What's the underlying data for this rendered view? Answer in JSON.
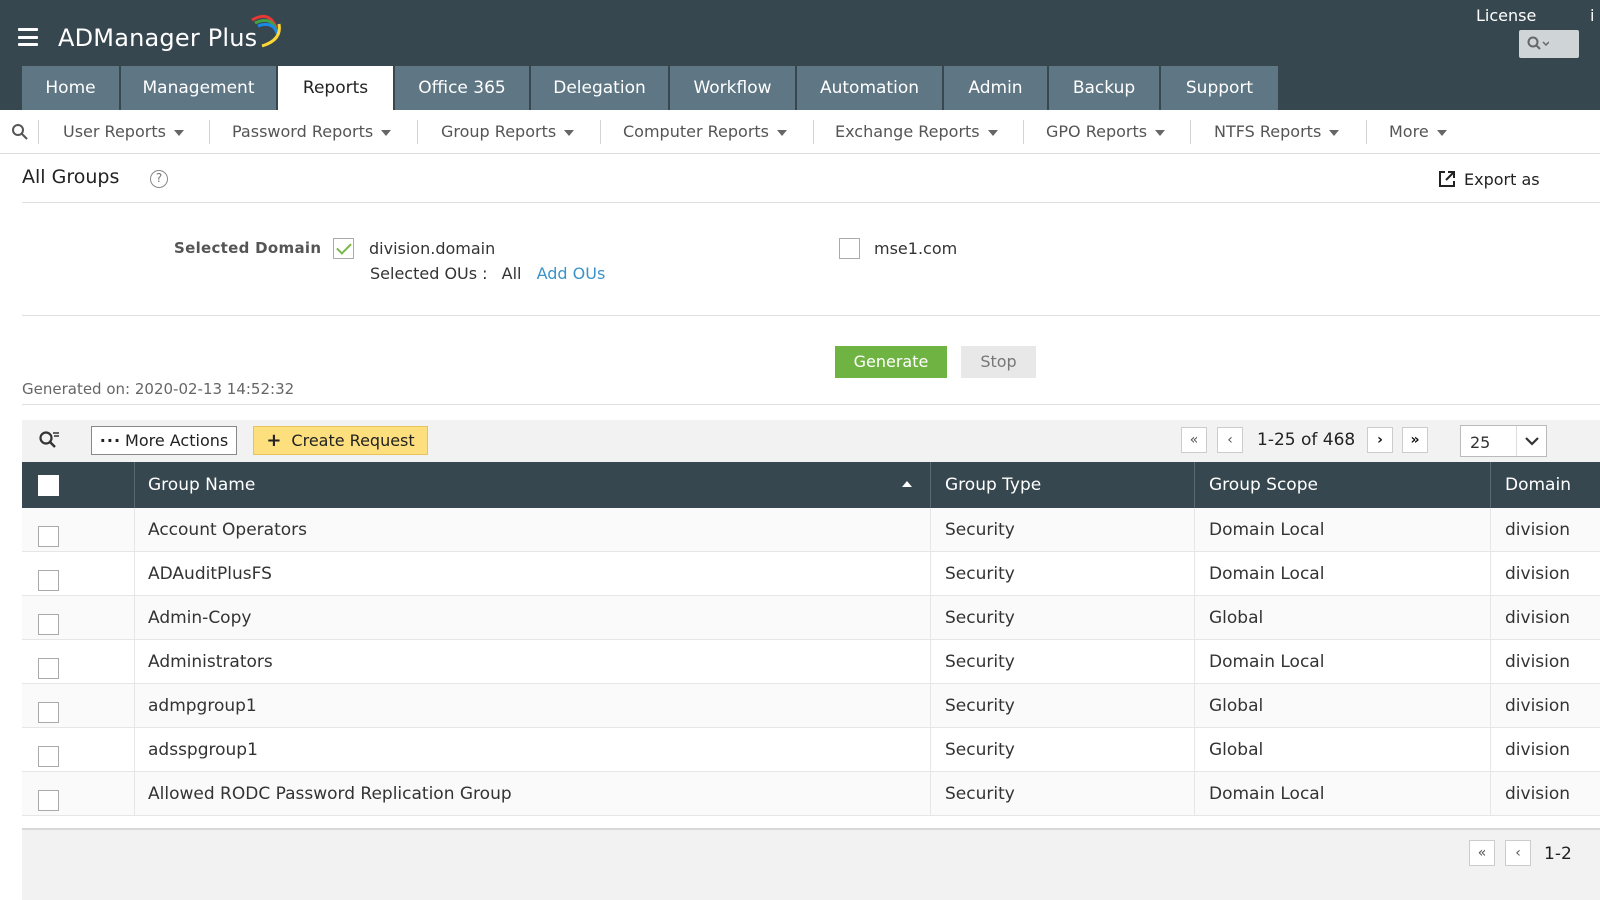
{
  "header": {
    "app_name": "ADManager Plus",
    "license_label": "License",
    "info_glyph": "i"
  },
  "main_tabs": [
    {
      "label": "Home",
      "active": false
    },
    {
      "label": "Management",
      "active": false
    },
    {
      "label": "Reports",
      "active": true
    },
    {
      "label": "Office 365",
      "active": false
    },
    {
      "label": "Delegation",
      "active": false
    },
    {
      "label": "Workflow",
      "active": false
    },
    {
      "label": "Automation",
      "active": false
    },
    {
      "label": "Admin",
      "active": false
    },
    {
      "label": "Backup",
      "active": false
    },
    {
      "label": "Support",
      "active": false
    }
  ],
  "sub_nav": [
    {
      "label": "User Reports"
    },
    {
      "label": "Password Reports"
    },
    {
      "label": "Group Reports"
    },
    {
      "label": "Computer Reports"
    },
    {
      "label": "Exchange Reports"
    },
    {
      "label": "GPO Reports"
    },
    {
      "label": "NTFS Reports"
    },
    {
      "label": "More"
    }
  ],
  "page": {
    "title": "All Groups",
    "help_glyph": "?",
    "export_label": "Export as"
  },
  "domain_selection": {
    "label": "Selected Domain",
    "domains": [
      {
        "name": "division.domain",
        "checked": true
      },
      {
        "name": "mse1.com",
        "checked": false
      }
    ],
    "selected_ous_label": "Selected OUs :",
    "selected_ous_value": "All",
    "add_ous_label": "Add OUs"
  },
  "actions": {
    "generate_label": "Generate",
    "stop_label": "Stop",
    "generated_on": "Generated on: 2020-02-13 14:52:32"
  },
  "toolbar": {
    "more_actions_label": "More Actions",
    "create_request_label": "Create Request",
    "page_info": "1-25 of 468",
    "page_size": "25",
    "colors": {
      "create_request_bg": "#fddf7e",
      "generate_bg": "#6fb443"
    }
  },
  "table": {
    "columns": [
      "Group Name",
      "Group Type",
      "Group Scope",
      "Domain"
    ],
    "sort_column": "Group Name",
    "sort_direction": "asc",
    "rows": [
      {
        "name": "Account Operators",
        "type": "Security",
        "scope": "Domain Local",
        "domain": "division"
      },
      {
        "name": "ADAuditPlusFS",
        "type": "Security",
        "scope": "Domain Local",
        "domain": "division"
      },
      {
        "name": "Admin-Copy",
        "type": "Security",
        "scope": "Global",
        "domain": "division"
      },
      {
        "name": "Administrators",
        "type": "Security",
        "scope": "Domain Local",
        "domain": "division"
      },
      {
        "name": "admpgroup1",
        "type": "Security",
        "scope": "Global",
        "domain": "division"
      },
      {
        "name": "adsspgroup1",
        "type": "Security",
        "scope": "Global",
        "domain": "division"
      },
      {
        "name": "Allowed RODC Password Replication Group",
        "type": "Security",
        "scope": "Domain Local",
        "domain": "division"
      }
    ]
  },
  "footer": {
    "page_info_partial": "1-2"
  }
}
